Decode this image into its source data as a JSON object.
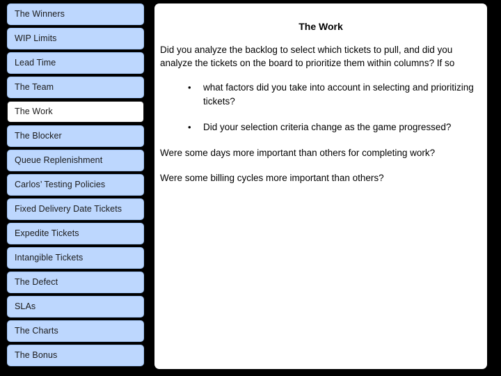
{
  "slide": {
    "background_color": "#000000",
    "accent_color": "#bdd7fe",
    "panel_color": "#ffffff",
    "text_color": "#000000"
  },
  "sidebar": {
    "items": [
      {
        "label": "The Winners",
        "selected": false
      },
      {
        "label": "WIP Limits",
        "selected": false
      },
      {
        "label": "Lead Time",
        "selected": false
      },
      {
        "label": "The Team",
        "selected": false
      },
      {
        "label": "The Work",
        "selected": true
      },
      {
        "label": "The Blocker",
        "selected": false
      },
      {
        "label": "Queue Replenishment",
        "selected": false
      },
      {
        "label": "Carlos’ Testing Policies",
        "selected": false
      },
      {
        "label": "Fixed Delivery Date Tickets",
        "selected": false
      },
      {
        "label": "Expedite Tickets",
        "selected": false
      },
      {
        "label": "Intangible Tickets",
        "selected": false
      },
      {
        "label": "The Defect",
        "selected": false
      },
      {
        "label": "SLAs",
        "selected": false
      },
      {
        "label": "The Charts",
        "selected": false
      },
      {
        "label": "The Bonus",
        "selected": false
      }
    ]
  },
  "content": {
    "title": "The Work",
    "intro": "Did you analyze the backlog to select which tickets to pull, and did you analyze the tickets on the board to prioritize them within columns? If so",
    "bullet_char": "•",
    "bullets": [
      "what factors did you take into account in selecting and prioritizing tickets?",
      "Did your selection criteria change as the game progressed?"
    ],
    "closing_paragraphs": [
      "Were some days more important than others for completing work?",
      "Were some billing cycles more important than others?"
    ]
  }
}
